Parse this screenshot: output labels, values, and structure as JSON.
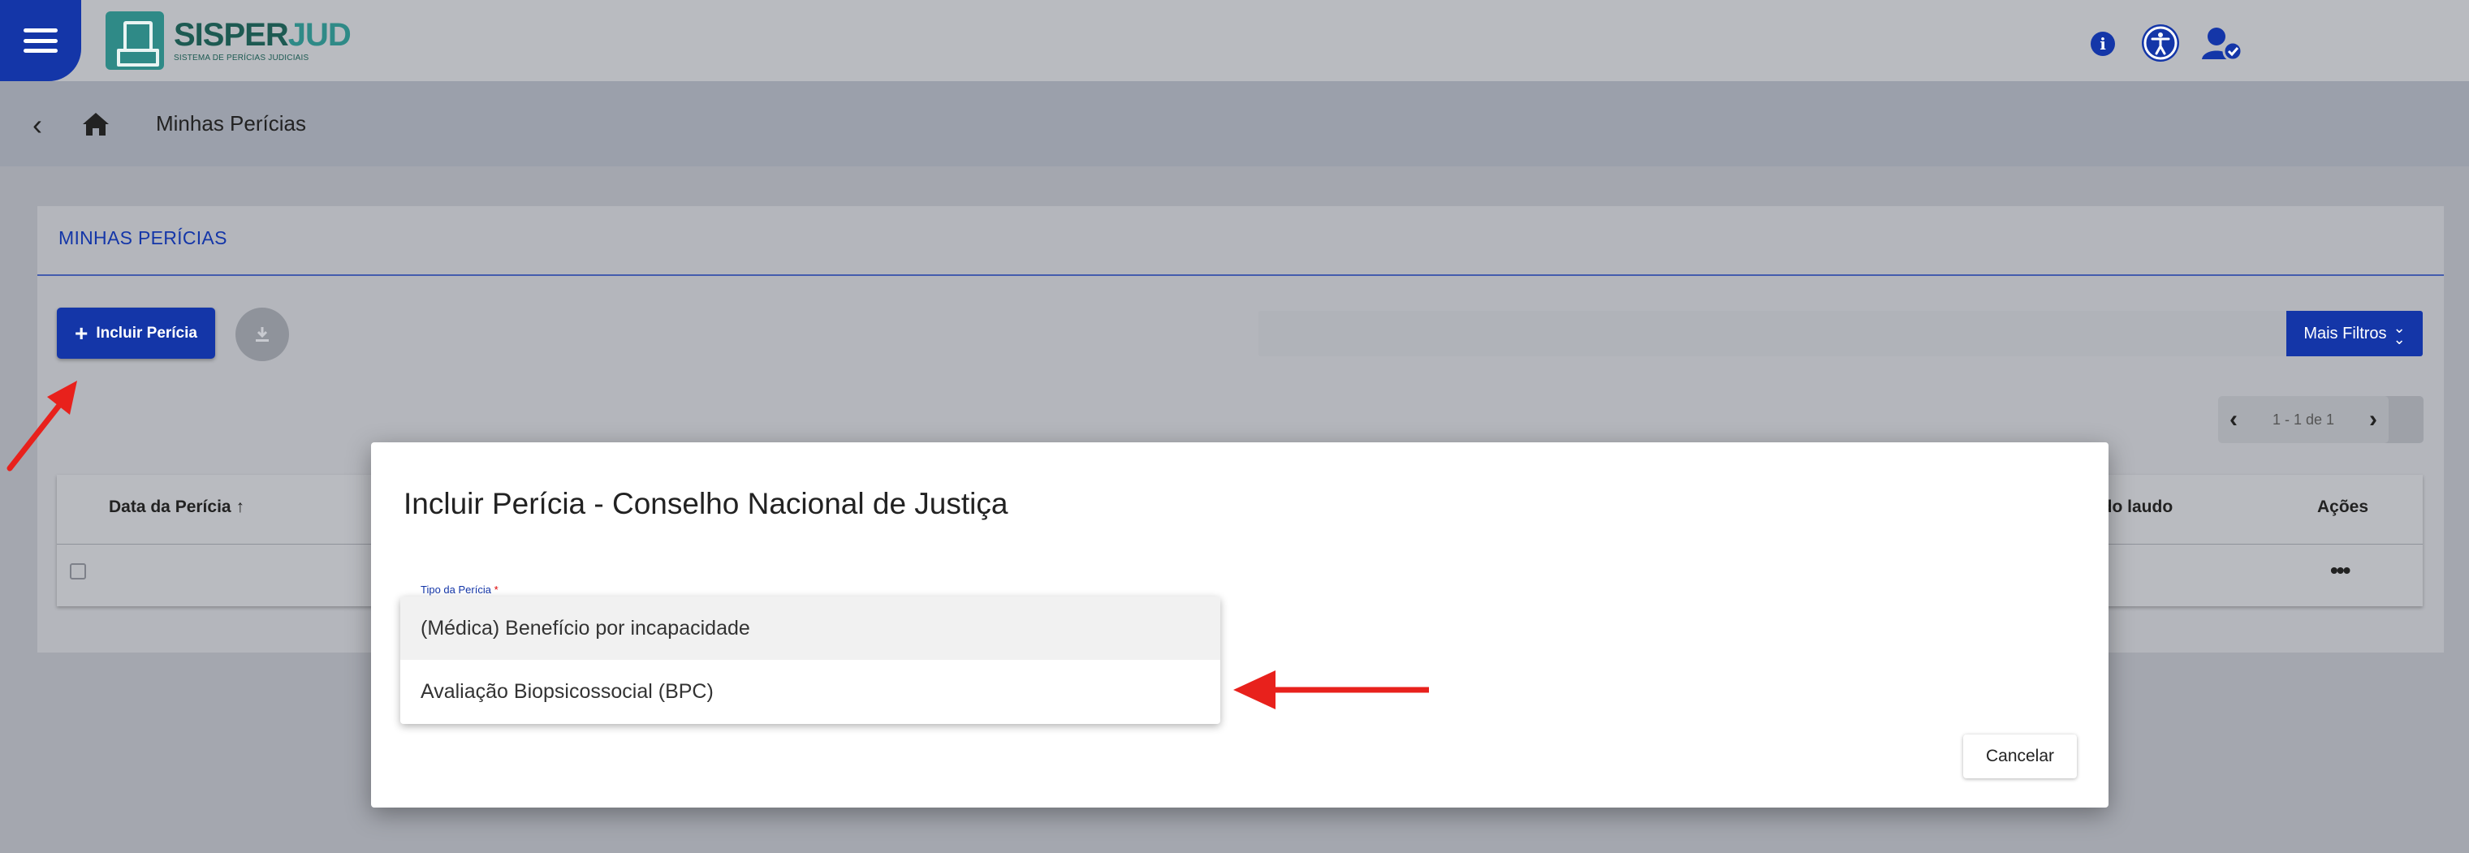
{
  "header": {
    "logo_name_part1": "SISPER",
    "logo_name_part2": "JUD",
    "logo_subtitle": "SISTEMA DE PERÍCIAS JUDICIAIS",
    "icons": [
      "menu-icon",
      "info-icon",
      "accessibility-icon",
      "user-account-icon"
    ]
  },
  "breadcrumb": {
    "title": "Minhas Perícias"
  },
  "page": {
    "section_title": "MINHAS PERÍCIAS",
    "add_button_label": "Incluir Perícia",
    "filter_button_label": "Mais Filtros",
    "pagination_text": "1 - 1 de 1",
    "table_headers": {
      "date": "Data da Perícia",
      "report": "o do laudo",
      "actions": "Ações"
    }
  },
  "modal": {
    "title": "Incluir Perícia - Conselho Nacional de Justiça",
    "field_label": "Tipo da Perícia",
    "required_mark": "*",
    "options": [
      "(Médica) Benefício por incapacidade",
      "Avaliação Biopsicossocial (BPC)"
    ],
    "cancel_label": "Cancelar"
  },
  "colors": {
    "primary": "#1436a8",
    "annotation_arrow": "#e8211c"
  }
}
